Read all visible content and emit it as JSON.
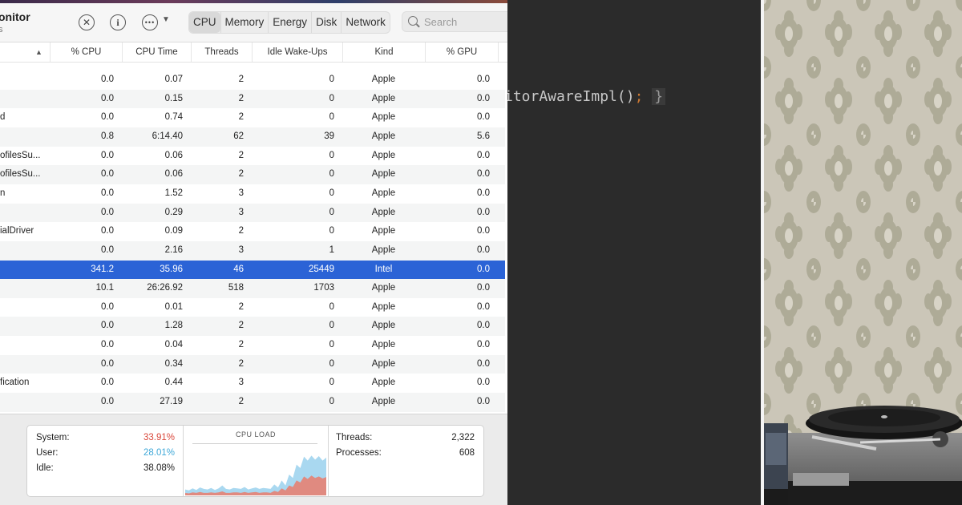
{
  "activity_monitor": {
    "title": "onitor",
    "subtitle": "s",
    "toolbar_icons": [
      "stop-process-icon",
      "info-icon",
      "more-actions-icon",
      "chevron-down-icon",
      "search-icon"
    ],
    "tabs": [
      "CPU",
      "Memory",
      "Energy",
      "Disk",
      "Network"
    ],
    "selected_tab": "CPU",
    "search_placeholder": "Search",
    "columns": [
      "% CPU",
      "CPU Time",
      "Threads",
      "Idle Wake-Ups",
      "Kind",
      "% GPU"
    ],
    "rows": [
      {
        "name": "",
        "cpu": "0.0",
        "time": "0.07",
        "threads": "2",
        "wakeups": "0",
        "kind": "Apple",
        "gpu": "0.0"
      },
      {
        "name": "",
        "cpu": "0.0",
        "time": "0.15",
        "threads": "2",
        "wakeups": "0",
        "kind": "Apple",
        "gpu": "0.0"
      },
      {
        "name": "d",
        "cpu": "0.0",
        "time": "0.74",
        "threads": "2",
        "wakeups": "0",
        "kind": "Apple",
        "gpu": "0.0"
      },
      {
        "name": "",
        "cpu": "0.8",
        "time": "6:14.40",
        "threads": "62",
        "wakeups": "39",
        "kind": "Apple",
        "gpu": "5.6"
      },
      {
        "name": "ofilesSu...",
        "cpu": "0.0",
        "time": "0.06",
        "threads": "2",
        "wakeups": "0",
        "kind": "Apple",
        "gpu": "0.0"
      },
      {
        "name": "ofilesSu...",
        "cpu": "0.0",
        "time": "0.06",
        "threads": "2",
        "wakeups": "0",
        "kind": "Apple",
        "gpu": "0.0"
      },
      {
        "name": "n",
        "cpu": "0.0",
        "time": "1.52",
        "threads": "3",
        "wakeups": "0",
        "kind": "Apple",
        "gpu": "0.0"
      },
      {
        "name": "",
        "cpu": "0.0",
        "time": "0.29",
        "threads": "3",
        "wakeups": "0",
        "kind": "Apple",
        "gpu": "0.0"
      },
      {
        "name": "ialDriver",
        "cpu": "0.0",
        "time": "0.09",
        "threads": "2",
        "wakeups": "0",
        "kind": "Apple",
        "gpu": "0.0"
      },
      {
        "name": "",
        "cpu": "0.0",
        "time": "2.16",
        "threads": "3",
        "wakeups": "1",
        "kind": "Apple",
        "gpu": "0.0"
      },
      {
        "name": "",
        "cpu": "341.2",
        "time": "35.96",
        "threads": "46",
        "wakeups": "25449",
        "kind": "Intel",
        "gpu": "0.0"
      },
      {
        "name": "",
        "cpu": "10.1",
        "time": "26:26.92",
        "threads": "518",
        "wakeups": "1703",
        "kind": "Apple",
        "gpu": "0.0"
      },
      {
        "name": "",
        "cpu": "0.0",
        "time": "0.01",
        "threads": "2",
        "wakeups": "0",
        "kind": "Apple",
        "gpu": "0.0"
      },
      {
        "name": "",
        "cpu": "0.0",
        "time": "1.28",
        "threads": "2",
        "wakeups": "0",
        "kind": "Apple",
        "gpu": "0.0"
      },
      {
        "name": "",
        "cpu": "0.0",
        "time": "0.04",
        "threads": "2",
        "wakeups": "0",
        "kind": "Apple",
        "gpu": "0.0"
      },
      {
        "name": "",
        "cpu": "0.0",
        "time": "0.34",
        "threads": "2",
        "wakeups": "0",
        "kind": "Apple",
        "gpu": "0.0"
      },
      {
        "name": "fication",
        "cpu": "0.0",
        "time": "0.44",
        "threads": "3",
        "wakeups": "0",
        "kind": "Apple",
        "gpu": "0.0"
      },
      {
        "name": "",
        "cpu": "0.0",
        "time": "27.19",
        "threads": "2",
        "wakeups": "0",
        "kind": "Apple",
        "gpu": "0.0"
      }
    ],
    "selected_row_index": 10,
    "footer": {
      "system_label": "System:",
      "system_value": "33.91%",
      "user_label": "User:",
      "user_value": "28.01%",
      "idle_label": "Idle:",
      "idle_value": "38.08%",
      "cpu_load_title": "CPU LOAD",
      "threads_label": "Threads:",
      "threads_value": "2,322",
      "processes_label": "Processes:",
      "processes_value": "608",
      "system_color": "#d9473a",
      "user_color": "#3fa8d8",
      "cpu_load_user": [
        0.12,
        0.1,
        0.14,
        0.11,
        0.16,
        0.13,
        0.12,
        0.15,
        0.11,
        0.14,
        0.2,
        0.13,
        0.12,
        0.15,
        0.14,
        0.13,
        0.17,
        0.12,
        0.14,
        0.16,
        0.13,
        0.15,
        0.14,
        0.13,
        0.22,
        0.16,
        0.3,
        0.2,
        0.42,
        0.35,
        0.62,
        0.55,
        0.78,
        0.7,
        0.8,
        0.72,
        0.79,
        0.7,
        0.76
      ],
      "cpu_load_system": [
        0.05,
        0.04,
        0.06,
        0.05,
        0.07,
        0.05,
        0.05,
        0.06,
        0.05,
        0.06,
        0.08,
        0.05,
        0.05,
        0.06,
        0.06,
        0.05,
        0.07,
        0.05,
        0.06,
        0.07,
        0.05,
        0.06,
        0.06,
        0.05,
        0.09,
        0.07,
        0.14,
        0.1,
        0.2,
        0.17,
        0.3,
        0.26,
        0.38,
        0.33,
        0.4,
        0.35,
        0.38,
        0.34,
        0.37
      ]
    }
  },
  "code_editor": {
    "code_text": "itorAwareImpl()",
    "code_punct": ";",
    "code_brace": "}",
    "background_color": "#2b2b2b"
  },
  "photo": {
    "description_icon": "turntable-on-damask-wallpaper"
  }
}
